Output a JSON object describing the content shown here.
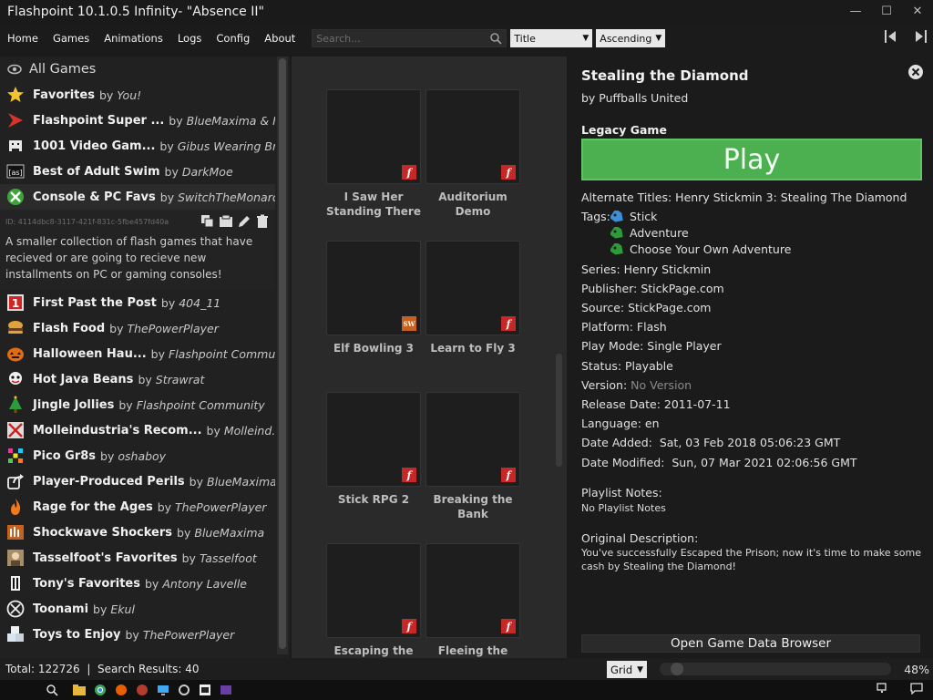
{
  "window": {
    "title": "Flashpoint 10.1.0.5 Infinity- \"Absence II\"",
    "controls": {
      "minimize": "—",
      "maximize": "☐",
      "close": "✕"
    }
  },
  "menu": {
    "items": [
      "Home",
      "Games",
      "Animations",
      "Logs",
      "Config",
      "About"
    ],
    "search_placeholder": "Search...",
    "order_by": "Title",
    "order_dir": "Ascending"
  },
  "sidebar": {
    "all_games": "All Games",
    "playlists_top": [
      {
        "title": "Favorites",
        "author": "You!",
        "icon": "star-icon"
      },
      {
        "title": "Flashpoint Super ...",
        "author": "BlueMaxima & Fl...",
        "icon": "flashpoint-icon"
      },
      {
        "title": "1001 Video Gam...",
        "author": "Gibus Wearing Bro...",
        "icon": "invader-icon"
      },
      {
        "title": "Best of Adult Swim",
        "author": "DarkMoe",
        "icon": "adultswim-icon"
      },
      {
        "title": "Console & PC Favs",
        "author": "SwitchTheMonarch",
        "icon": "xbox-icon"
      }
    ],
    "selected_id": "ID: 4114dbc8-3117-421f-831c-5fbe457fd40a",
    "selected_description": "A smaller collection of flash games that have recieved or are going to recieve new installments on PC or gaming consoles!",
    "playlists_bottom": [
      {
        "title": "First Past the Post",
        "author": "404_11",
        "icon": "one-icon"
      },
      {
        "title": "Flash Food",
        "author": "ThePowerPlayer",
        "icon": "burger-icon"
      },
      {
        "title": "Halloween Hau...",
        "author": "Flashpoint Commu...",
        "icon": "pumpkin-icon"
      },
      {
        "title": "Hot Java Beans",
        "author": "Strawrat",
        "icon": "java-icon"
      },
      {
        "title": "Jingle Jollies",
        "author": "Flashpoint Community",
        "icon": "tree-icon"
      },
      {
        "title": "Molleindustria's Recom...",
        "author": "Molleind...",
        "icon": "molleindustria-icon"
      },
      {
        "title": "Pico Gr8s",
        "author": "oshaboy",
        "icon": "pixel-icon"
      },
      {
        "title": "Player-Produced Perils",
        "author": "BlueMaxima",
        "icon": "share-icon"
      },
      {
        "title": "Rage for the Ages",
        "author": "ThePowerPlayer",
        "icon": "flame-icon"
      },
      {
        "title": "Shockwave Shockers",
        "author": "BlueMaxima",
        "icon": "shockwave-icon"
      },
      {
        "title": "Tasselfoot's Favorites",
        "author": "Tasselfoot",
        "icon": "avatar-icon"
      },
      {
        "title": "Tony's Favorites",
        "author": "Antony Lavelle",
        "icon": "figure-icon"
      },
      {
        "title": "Toonami",
        "author": "Ekul",
        "icon": "toonami-icon"
      },
      {
        "title": "Toys to Enjoy",
        "author": "ThePowerPlayer",
        "icon": "blocks-icon"
      }
    ],
    "by_word": "by"
  },
  "grid": {
    "tiles": [
      {
        "name": "I Saw Her Standing There",
        "platform": "flash"
      },
      {
        "name": "Auditorium Demo",
        "platform": "flash"
      },
      {
        "name": "Elf Bowling 3",
        "platform": "shockwave"
      },
      {
        "name": "Learn to Fly 3",
        "platform": "flash"
      },
      {
        "name": "Stick RPG 2",
        "platform": "flash"
      },
      {
        "name": "Breaking the Bank",
        "platform": "flash"
      },
      {
        "name": "Escaping the",
        "platform": "flash"
      },
      {
        "name": "Fleeing the",
        "platform": "flash"
      }
    ],
    "flash_glyph": "f",
    "shockwave_glyph": "SW"
  },
  "details": {
    "title": "Stealing the Diamond",
    "developer": "by Puffballs United",
    "legacy": "Legacy Game",
    "play": "Play",
    "alternate_titles": "Alternate Titles: Henry Stickmin 3: Stealing The Diamond",
    "tags_label": "Tags:",
    "tags": [
      "Stick",
      "Adventure",
      "Choose Your Own Adventure"
    ],
    "series": "Series: Henry Stickmin",
    "publisher": "Publisher: StickPage.com",
    "source": "Source: StickPage.com",
    "platform": "Platform: Flash",
    "play_mode": "Play Mode: Single Player",
    "status": "Status: Playable",
    "version_label": "Version:",
    "version_value": "No Version",
    "release_date": "Release Date: 2011-07-11",
    "language": "Language: en",
    "date_added": "Date Added:  Sat, 03 Feb 2018 05:06:23 GMT",
    "date_modified": "Date Modified:  Sun, 07 Mar 2021 02:06:56 GMT",
    "playlist_notes_label": "Playlist Notes:",
    "playlist_notes_value": "No Playlist Notes",
    "original_description_label": "Original Description:",
    "original_description": "You've successfully Escaped the Prison; now it's time to make some cash by Stealing the Diamond!",
    "open_browser": "Open Game Data Browser"
  },
  "status": {
    "text": "Total: 122726  |  Search Results: 40",
    "view": "Grid",
    "zoom": "48%",
    "zoom_level": 0.48
  },
  "colors": {
    "play_green": "#4caf50",
    "flash_red": "#c62828",
    "tag_blue": "#3d8fd6",
    "tag_green": "#2e9b3b"
  }
}
